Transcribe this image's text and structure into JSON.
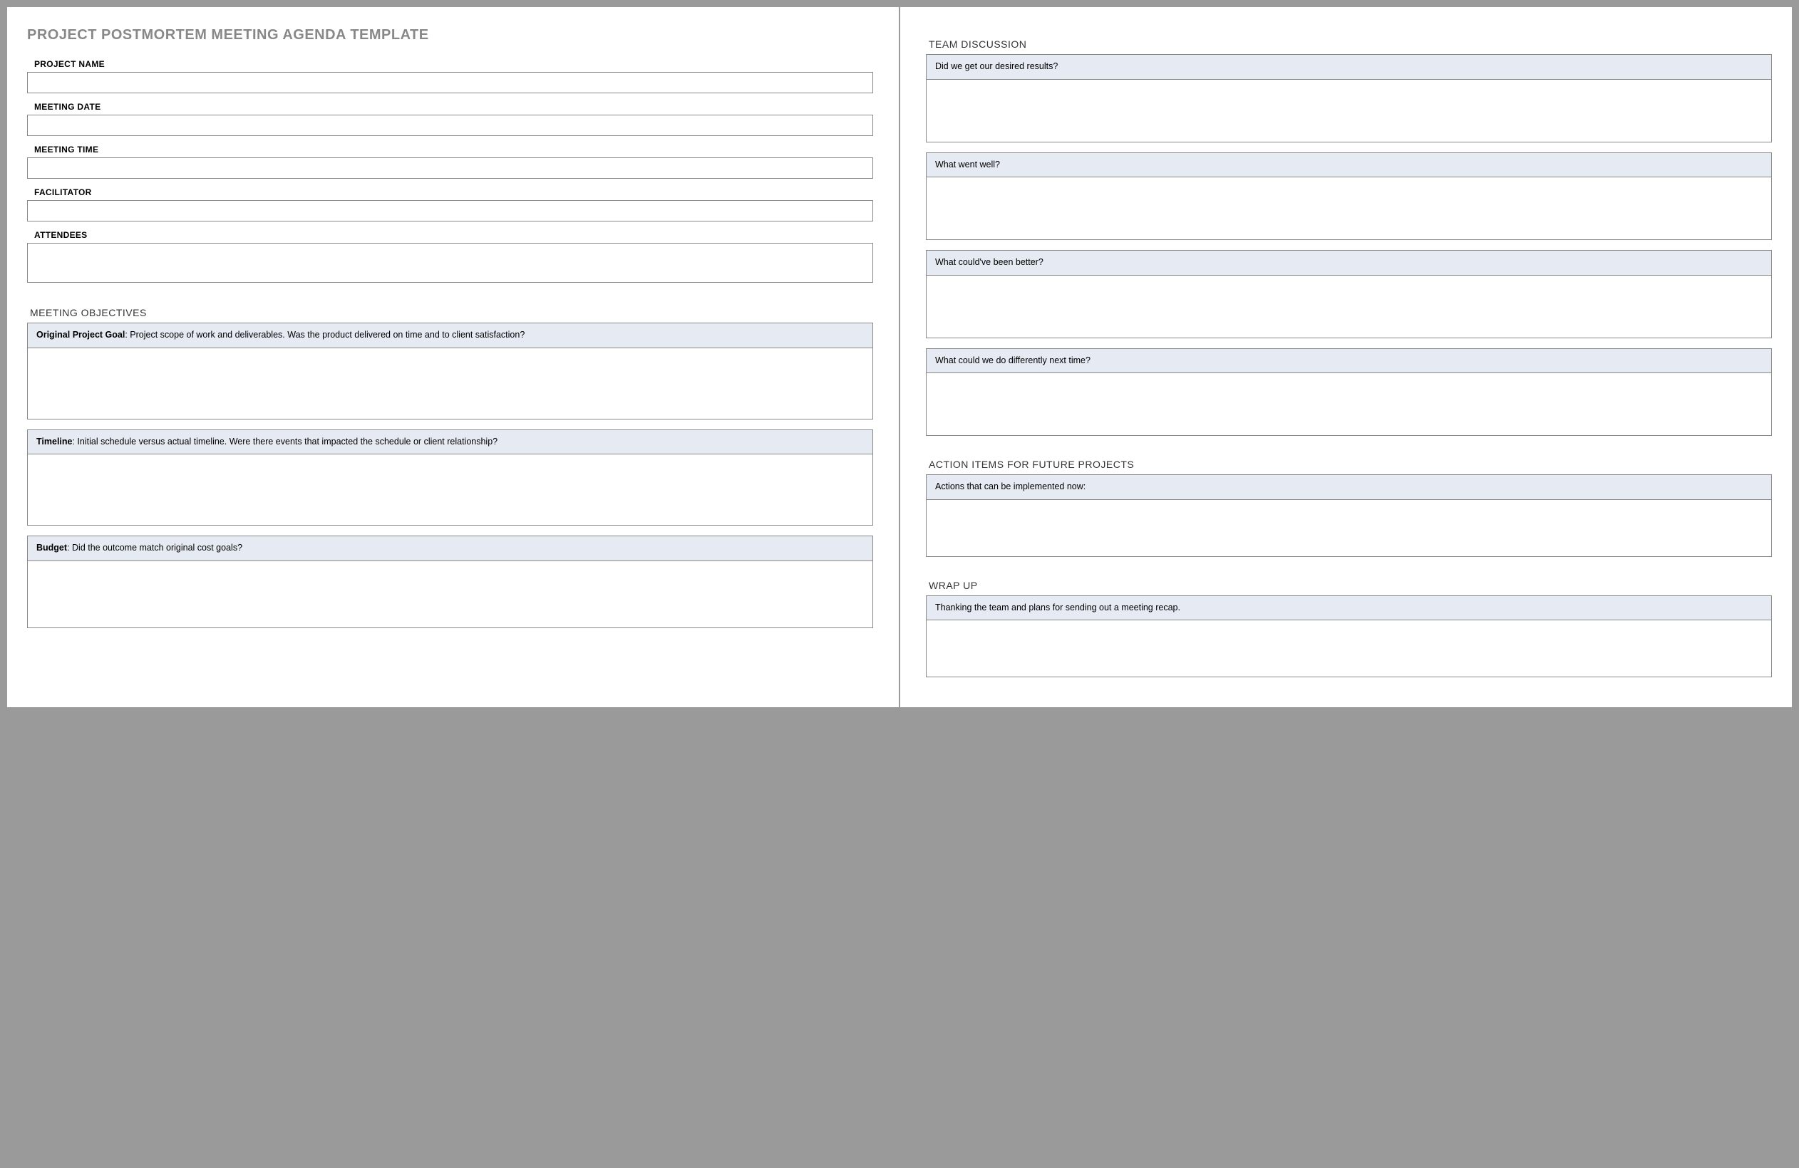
{
  "title": "PROJECT POSTMORTEM MEETING AGENDA TEMPLATE",
  "fields": {
    "project_name": "PROJECT NAME",
    "meeting_date": "MEETING DATE",
    "meeting_time": "MEETING TIME",
    "facilitator": "FACILITATOR",
    "attendees": "ATTENDEES"
  },
  "objectives": {
    "heading": "MEETING OBJECTIVES",
    "items": [
      {
        "bold": "Original Project Goal",
        "rest": ": Project scope of work and deliverables. Was the product delivered on time and to client satisfaction?"
      },
      {
        "bold": "Timeline",
        "rest": ": Initial schedule versus actual timeline. Were there events that impacted the schedule or client relationship?"
      },
      {
        "bold": "Budget",
        "rest": ": Did the outcome match original cost goals?"
      }
    ]
  },
  "discussion": {
    "heading": "TEAM DISCUSSION",
    "items": [
      "Did we get our desired results?",
      "What went well?",
      "What could've been better?",
      "What could we do differently next time?"
    ]
  },
  "action_items": {
    "heading": "ACTION ITEMS FOR FUTURE PROJECTS",
    "prompt": "Actions that can be implemented now:"
  },
  "wrap_up": {
    "heading": "WRAP UP",
    "prompt": "Thanking the team and plans for sending out a meeting recap."
  }
}
